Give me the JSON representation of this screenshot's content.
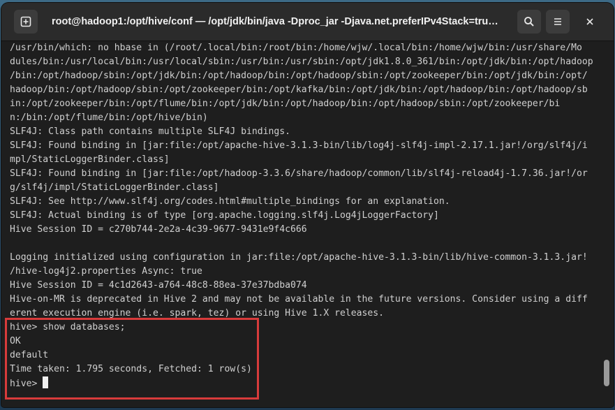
{
  "window": {
    "title": "root@hadoop1:/opt/hive/conf — /opt/jdk/bin/java -Dproc_jar -Djava.net.preferIPv4Stack=tru…"
  },
  "icons": {
    "new_tab": "new-tab-icon",
    "search": "search-icon",
    "menu": "hamburger-menu-icon",
    "close": "close-icon"
  },
  "terminal": {
    "lines": [
      "/usr/bin/which: no hbase in (/root/.local/bin:/root/bin:/home/wjw/.local/bin:/home/wjw/bin:/usr/share/Mo",
      "dules/bin:/usr/local/bin:/usr/local/sbin:/usr/bin:/usr/sbin:/opt/jdk1.8.0_361/bin:/opt/jdk/bin:/opt/hadoop",
      "/bin:/opt/hadoop/sbin:/opt/jdk/bin:/opt/hadoop/bin:/opt/hadoop/sbin:/opt/zookeeper/bin:/opt/jdk/bin:/opt/",
      "hadoop/bin:/opt/hadoop/sbin:/opt/zookeeper/bin:/opt/kafka/bin:/opt/jdk/bin:/opt/hadoop/bin:/opt/hadoop/sb",
      "in:/opt/zookeeper/bin:/opt/flume/bin:/opt/jdk/bin:/opt/hadoop/bin:/opt/hadoop/sbin:/opt/zookeeper/bi",
      "n:/bin:/opt/flume/bin:/opt/hive/bin)",
      "SLF4J: Class path contains multiple SLF4J bindings.",
      "SLF4J: Found binding in [jar:file:/opt/apache-hive-3.1.3-bin/lib/log4j-slf4j-impl-2.17.1.jar!/org/slf4j/i",
      "mpl/StaticLoggerBinder.class]",
      "SLF4J: Found binding in [jar:file:/opt/hadoop-3.3.6/share/hadoop/common/lib/slf4j-reload4j-1.7.36.jar!/or",
      "g/slf4j/impl/StaticLoggerBinder.class]",
      "SLF4J: See http://www.slf4j.org/codes.html#multiple_bindings for an explanation.",
      "SLF4J: Actual binding is of type [org.apache.logging.slf4j.Log4jLoggerFactory]",
      "Hive Session ID = c270b744-2e2a-4c39-9677-9431e9f4c666",
      "",
      "Logging initialized using configuration in jar:file:/opt/apache-hive-3.1.3-bin/lib/hive-common-3.1.3.jar!",
      "/hive-log4j2.properties Async: true",
      "Hive Session ID = 4c1d2643-a764-48c8-88ea-37e37bdba074",
      "Hive-on-MR is deprecated in Hive 2 and may not be available in the future versions. Consider using a diff",
      "erent execution engine (i.e. spark, tez) or using Hive 1.X releases.",
      "hive> show databases;",
      "OK",
      "default",
      "Time taken: 1.795 seconds, Fetched: 1 row(s)"
    ],
    "prompt": "hive> "
  },
  "colors": {
    "terminal_bg": "#1e1e1e",
    "terminal_fg": "#d0d0d0",
    "titlebar_bg": "#2b2b2b",
    "highlight": "#d83b3b"
  }
}
